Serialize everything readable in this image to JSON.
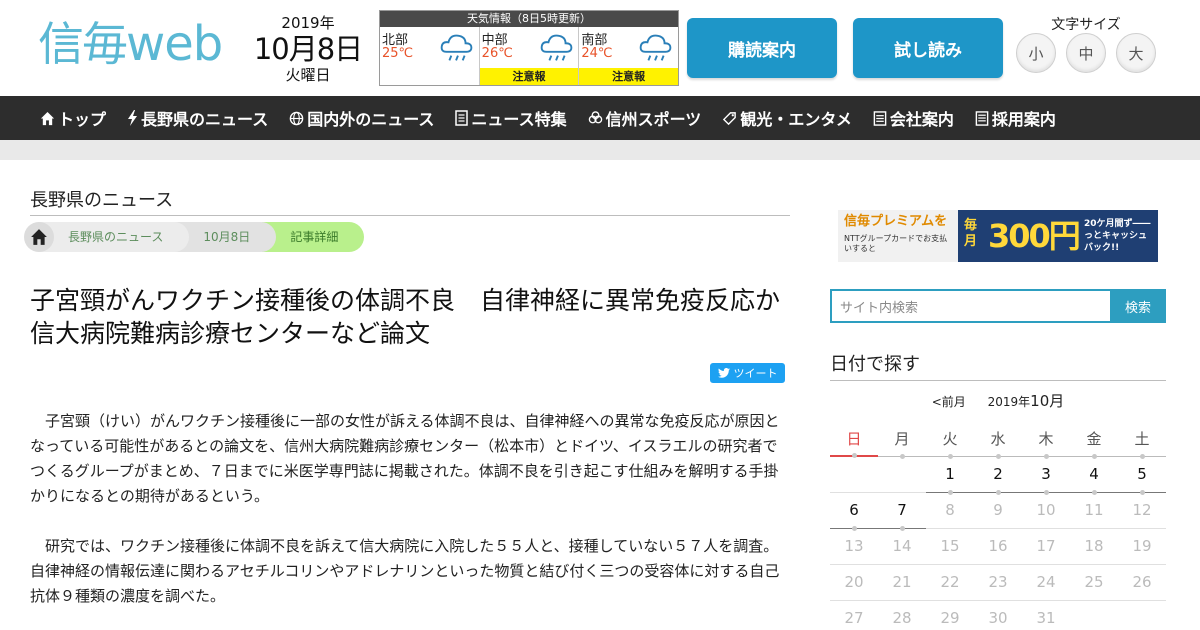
{
  "header": {
    "logo_kanji": "信毎",
    "logo_web": "web",
    "date": {
      "year": "2019年",
      "month_day": "10月8日",
      "weekday": "火曜日"
    },
    "weather": {
      "title": "天気情報（8日5時更新）",
      "regions": [
        {
          "name": "北部",
          "temp": "25℃",
          "alert": "",
          "icon": "rain-cloud-icon"
        },
        {
          "name": "中部",
          "temp": "26℃",
          "alert": "注意報",
          "icon": "rain-cloud-icon"
        },
        {
          "name": "南部",
          "temp": "24℃",
          "alert": "注意報",
          "icon": "rain-cloud-icon"
        }
      ],
      "temp_color": "#e8532a",
      "alert_color": "#fff200"
    },
    "subscribe_label": "購読案内",
    "trial_label": "試し読み",
    "fontsize": {
      "label": "文字サイズ",
      "small": "小",
      "medium": "中",
      "large": "大"
    }
  },
  "nav": {
    "items": [
      {
        "label": "トップ",
        "icon": "home-icon"
      },
      {
        "label": "長野県のニュース",
        "icon": "lightning-icon"
      },
      {
        "label": "国内外のニュース",
        "icon": "globe-icon"
      },
      {
        "label": "ニュース特集",
        "icon": "document-icon"
      },
      {
        "label": "信州スポーツ",
        "icon": "ball-icon"
      },
      {
        "label": "観光・エンタメ",
        "icon": "tag-icon"
      },
      {
        "label": "会社案内",
        "icon": "building-icon"
      },
      {
        "label": "採用案内",
        "icon": "list-icon"
      }
    ],
    "bg_color": "#2d2d2d"
  },
  "main": {
    "section_title": "長野県のニュース",
    "breadcrumb": [
      "長野県のニュース",
      "10月8日",
      "記事詳細"
    ],
    "headline": "子宮頸がんワクチン接種後の体調不良　自律神経に異常免疫反応か　信大病院難病診療センターなど論文",
    "tweet_label": "ツイート",
    "paragraphs": [
      "子宮頸（けい）がんワクチン接種後に一部の女性が訴える体調不良は、自律神経への異常な免疫反応が原因となっている可能性があるとの論文を、信州大病院難病診療センター（松本市）とドイツ、イスラエルの研究者でつくるグループがまとめ、７日までに米医学専門誌に掲載された。体調不良を引き起こす仕組みを解明する手掛かりになるとの期待があるという。",
      "研究では、ワクチン接種後に体調不良を訴えて信大病院に入院した５５人と、接種していない５７人を調査。自律神経の情報伝達に関わるアセチルコリンやアドレナリンといった物質と結び付く三つの受容体に対する自己抗体９種類の濃度を調べた。"
    ]
  },
  "sidebar": {
    "banner": {
      "brand": "信毎プレミアムを",
      "sub": "NTTグループカードでお支払いすると",
      "monthly": "毎月",
      "amount": "300円",
      "promo": "20ケ月間ず――っとキャッシュバック!!"
    },
    "search": {
      "placeholder": "サイト内検索",
      "button": "検索"
    },
    "calendar": {
      "title": "日付で探す",
      "prev": "<前月",
      "year": "2019年",
      "month": "10月",
      "weekdays": [
        "日",
        "月",
        "火",
        "水",
        "木",
        "金",
        "土"
      ],
      "weeks": [
        [
          "",
          "",
          "1",
          "2",
          "3",
          "4",
          "5"
        ],
        [
          "6",
          "7",
          "8",
          "9",
          "10",
          "11",
          "12"
        ],
        [
          "13",
          "14",
          "15",
          "16",
          "17",
          "18",
          "19"
        ],
        [
          "20",
          "21",
          "22",
          "23",
          "24",
          "25",
          "26"
        ],
        [
          "27",
          "28",
          "29",
          "30",
          "31",
          "",
          ""
        ]
      ],
      "last_active_day": 7,
      "sunday_color": "#e04848"
    }
  }
}
